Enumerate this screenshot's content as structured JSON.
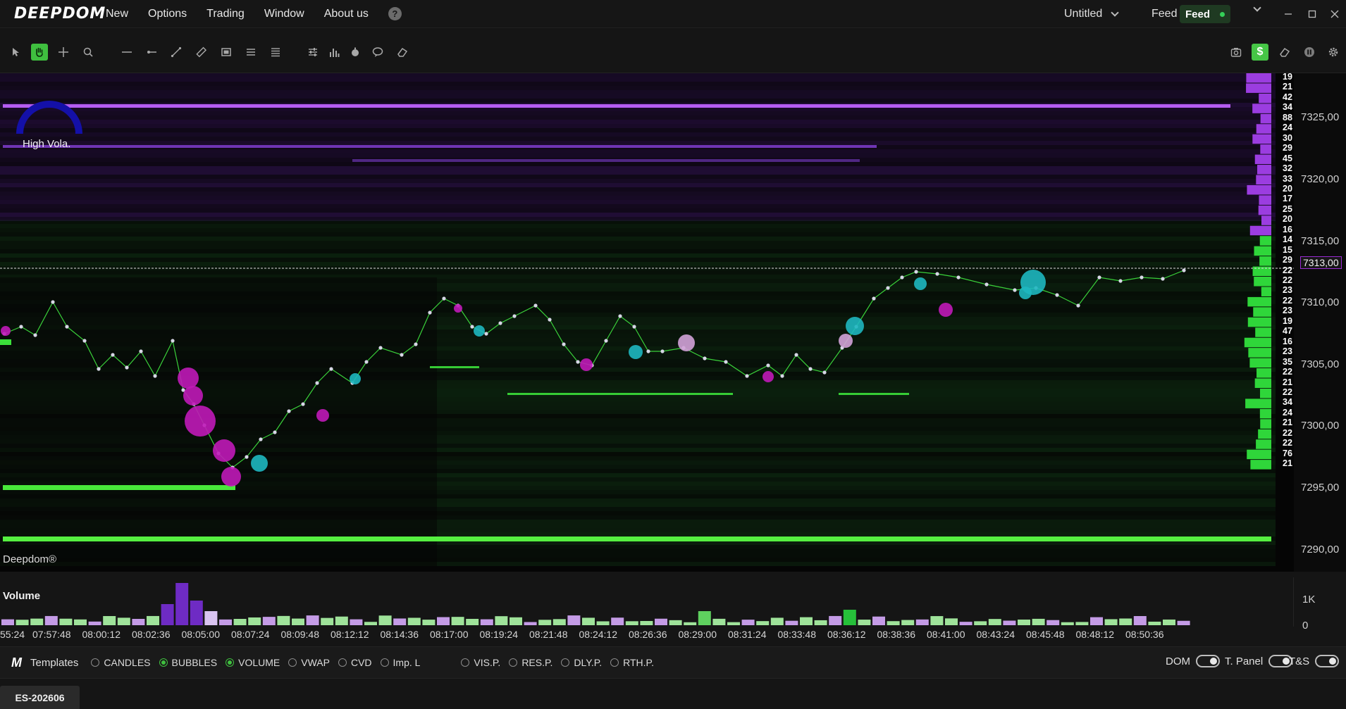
{
  "app": {
    "logo": "DEEPDOM"
  },
  "menu": [
    "New",
    "Options",
    "Trading",
    "Window",
    "About us"
  ],
  "help_icon": "?",
  "workspace": {
    "name": "Untitled"
  },
  "feed": {
    "label": "Feed",
    "status": "Feed",
    "status_color": "#34d058"
  },
  "window_controls": [
    "minimize",
    "maximize",
    "close"
  ],
  "toolbar": {
    "left_tools": [
      "pointer-icon",
      "hand-icon",
      "crosshair-icon",
      "zoom-icon",
      "hline-icon",
      "ray-icon",
      "trendline-icon",
      "ruler-icon",
      "rectangle-icon",
      "list-icon",
      "list-alt-icon",
      "sliders-icon",
      "bar-chart-icon",
      "timer-icon",
      "comment-icon",
      "eraser-icon"
    ],
    "right_tools": [
      "camera-icon",
      "dollar-icon",
      "eraser-icon",
      "pause-icon",
      "settings-icon"
    ]
  },
  "chart": {
    "high_vola_label": "High Vola.",
    "brand": "Deepdom®",
    "last_price": "7313,00",
    "price_ticks": [
      "7325,00",
      "7320,00",
      "7315,00",
      "7310,00",
      "7305,00",
      "7300,00",
      "7295,00",
      "7290,00"
    ],
    "ask_colors": "#9b3de0",
    "bid_colors": "#36e03a",
    "ladder_values": [
      "19",
      "21",
      "42",
      "34",
      "88",
      "24",
      "30",
      "29",
      "45",
      "32",
      "33",
      "20",
      "17",
      "25",
      "20",
      "16",
      "14",
      "15",
      "29",
      "22",
      "22",
      "23",
      "22",
      "23",
      "19",
      "47",
      "16",
      "23",
      "35",
      "22",
      "21",
      "22",
      "34",
      "24",
      "21",
      "22",
      "22",
      "76",
      "21"
    ]
  },
  "volume": {
    "title": "Volume",
    "ticks": [
      "1K",
      "0"
    ],
    "time_ticks": [
      "55:24",
      "07:57:48",
      "08:00:12",
      "08:02:36",
      "08:05:00",
      "08:07:24",
      "08:09:48",
      "08:12:12",
      "08:14:36",
      "08:17:00",
      "08:19:24",
      "08:21:48",
      "08:24:12",
      "08:26:36",
      "08:29:00",
      "08:31:24",
      "08:33:48",
      "08:36:12",
      "08:38:36",
      "08:41:00",
      "08:43:24",
      "08:45:48",
      "08:48:12",
      "08:50:36"
    ]
  },
  "bottom": {
    "templates_label": "Templates",
    "indicators": [
      {
        "label": "CANDLES",
        "on": false
      },
      {
        "label": "BUBBLES",
        "on": true
      },
      {
        "label": "VOLUME",
        "on": true
      },
      {
        "label": "VWAP",
        "on": false
      },
      {
        "label": "CVD",
        "on": false
      },
      {
        "label": "Imp. L",
        "on": false
      }
    ],
    "profiles": [
      "VIS.P.",
      "RES.P.",
      "DLY.P.",
      "RTH.P."
    ],
    "toggles": [
      "DOM",
      "T. Panel",
      "T&S"
    ]
  },
  "symbol_tab": "ES-202606"
}
